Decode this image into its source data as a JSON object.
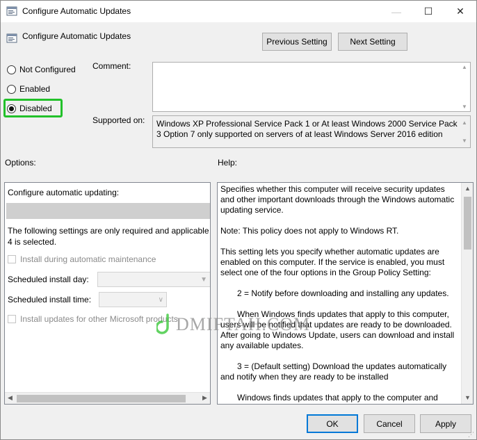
{
  "window": {
    "title": "Configure Automatic Updates",
    "controls": {
      "minimize": "—",
      "maximize": "☐",
      "close": "✕"
    }
  },
  "header": {
    "title": "Configure Automatic Updates"
  },
  "nav": {
    "previous_setting": "Previous Setting",
    "next_setting": "Next Setting"
  },
  "state": {
    "options": [
      "Not Configured",
      "Enabled",
      "Disabled"
    ],
    "selected": "Disabled"
  },
  "labels": {
    "comment": "Comment:",
    "supported_on": "Supported on:",
    "options": "Options:",
    "help": "Help:"
  },
  "comment": {
    "value": ""
  },
  "supported_on": {
    "value": "Windows XP Professional Service Pack 1 or At least Windows 2000 Service Pack 3 Option 7 only supported on servers of at least Windows Server 2016 edition"
  },
  "options_panel": {
    "configure_label": "Configure automatic updating:",
    "note_line1": "The following settings are only required and applicable",
    "note_line2": "4 is selected.",
    "install_during_maintenance": "Install during automatic maintenance",
    "scheduled_install_day": "Scheduled install day:",
    "scheduled_install_time": "Scheduled install time:",
    "install_other_products": "Install updates for other Microsoft products"
  },
  "help_panel": {
    "paragraphs": [
      "Specifies whether this computer will receive security updates and other important downloads through the Windows automatic updating service.",
      "Note: This policy does not apply to Windows RT.",
      "This setting lets you specify whether automatic updates are enabled on this computer. If the service is enabled, you must select one of the four options in the Group Policy Setting:",
      "2 = Notify before downloading and installing any updates.",
      "When Windows finds updates that apply to this computer, users will be notified that updates are ready to be downloaded. After going to Windows Update, users can download and install any available updates.",
      "3 = (Default setting) Download the updates automatically and notify when they are ready to be installed",
      "Windows finds updates that apply to the computer and"
    ]
  },
  "footer": {
    "ok": "OK",
    "cancel": "Cancel",
    "apply": "Apply"
  },
  "watermark": {
    "text": "DMIFTAH.COM"
  },
  "colors": {
    "highlight": "#22c12a",
    "focus_border": "#0078d7"
  }
}
